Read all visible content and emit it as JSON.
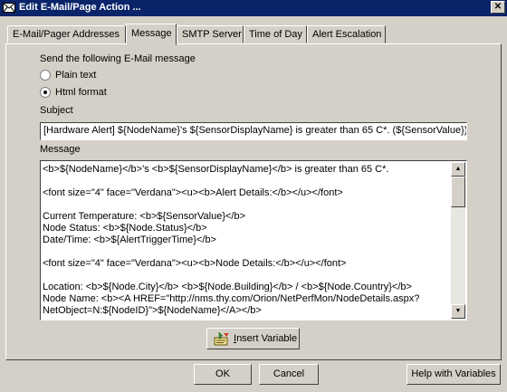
{
  "window": {
    "title": "Edit E-Mail/Page Action ...",
    "close_glyph": "✕"
  },
  "tabs": [
    {
      "label": "E-Mail/Pager Addresses",
      "active": false
    },
    {
      "label": "Message",
      "active": true
    },
    {
      "label": "SMTP Server",
      "active": false
    },
    {
      "label": "Time of Day",
      "active": false
    },
    {
      "label": "Alert Escalation",
      "active": false
    }
  ],
  "message_tab": {
    "format_label": "Send the following E-Mail message",
    "format_options": [
      {
        "label": "Plain text",
        "selected": false
      },
      {
        "label": "Html format",
        "selected": true
      }
    ],
    "subject_label": "Subject",
    "subject_value": "[Hardware Alert] ${NodeName}'s ${SensorDisplayName} is greater than 65 C*. (${SensorValue})",
    "message_label": "Message",
    "message_value": "<b>${NodeName}</b>'s <b>${SensorDisplayName}</b> is greater than 65 C*.\n\n<font size=\"4\" face=\"Verdana\"><u><b>Alert Details:</b></u></font>\n\nCurrent Temperature: <b>${SensorValue}</b>\nNode Status: <b>${Node.Status}</b>\nDate/Time: <b>${AlertTriggerTime}</b>\n\n<font size=\"4\" face=\"Verdana\"><u><b>Node Details:</b></u></font>\n\nLocation: <b>${Node.City}</b> <b>${Node.Building}</b> / <b>${Node.Country}</b>\nNode Name: <b><A HREF=\"http://nms.thy.com/Orion/NetPerfMon/NodeDetails.aspx?\nNetObject=N:${NodeID}\">${NodeName}</A></b>",
    "insert_variable_mnemonic": "I",
    "insert_variable_rest": "nsert Variable",
    "scroll_up_glyph": "▲",
    "scroll_down_glyph": "▼"
  },
  "footer": {
    "ok_label": "OK",
    "cancel_label": "Cancel",
    "help_label": "Help with Variables"
  },
  "icons": {
    "title": "envelope-icon",
    "insert_variable": "insert-variable-icon"
  },
  "colors": {
    "titlebar": "#0a246a",
    "face": "#d4d0c8"
  }
}
